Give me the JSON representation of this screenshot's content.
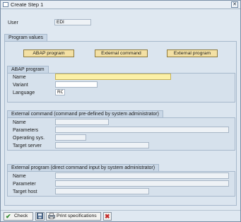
{
  "window": {
    "title": "Create Step  1",
    "close_glyph": "✕"
  },
  "user": {
    "label": "User",
    "value": "EDI"
  },
  "program_values": {
    "title": "Program values",
    "buttons": [
      "ABAP program",
      "External command",
      "External program"
    ]
  },
  "abap_program": {
    "title": "ABAP program",
    "fields": [
      {
        "label": "Name",
        "value": ""
      },
      {
        "label": "Variant",
        "value": ""
      },
      {
        "label": "Language",
        "value": "RO"
      }
    ]
  },
  "external_command": {
    "title": "External command (command pre-defined by system administrator)",
    "fields": [
      {
        "label": "Name",
        "value": ""
      },
      {
        "label": "Parameters",
        "value": ""
      },
      {
        "label": "Operating sys.",
        "value": ""
      },
      {
        "label": "Target server",
        "value": ""
      }
    ]
  },
  "external_program": {
    "title": "External program (direct command input by system administrator)",
    "fields": [
      {
        "label": "Name",
        "value": ""
      },
      {
        "label": "Parameter",
        "value": ""
      },
      {
        "label": "Target host",
        "value": ""
      }
    ]
  },
  "footer": {
    "check_label": "Check",
    "print_spec_label": "Print specifications",
    "icons": [
      "check-icon",
      "save-icon",
      "print-icon",
      "cancel-icon"
    ]
  },
  "colors": {
    "accent": "#f3e0a4",
    "focus_field": "#fbf0a7",
    "panel": "#dbe5ef"
  }
}
